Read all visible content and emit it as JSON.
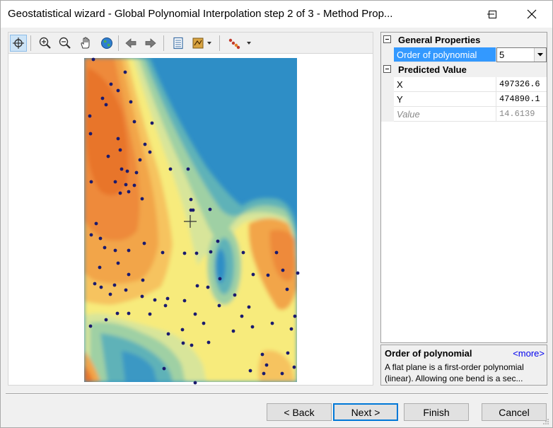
{
  "window": {
    "title": "Geostatistical wizard - Global Polynomial Interpolation step 2 of 3 - Method Prop..."
  },
  "titlebar_icons": [
    "minimize-icon",
    "maximize-icon",
    "close-icon"
  ],
  "toolbar": {
    "icons": [
      "crosshair-icon",
      "zoom-in-icon",
      "zoom-out-icon",
      "pan-hand-icon",
      "full-extent-globe-icon",
      "back-arrow-icon",
      "forward-arrow-icon",
      "table-of-contents-icon",
      "layer-dropdown-icon",
      "symbology-dropdown-icon"
    ]
  },
  "properties": {
    "general_category": "General Properties",
    "order_label": "Order of polynomial",
    "order_value": "5",
    "predicted_category": "Predicted Value",
    "x_label": "X",
    "x_value": "497326.6",
    "y_label": "Y",
    "y_value": "474890.1",
    "value_label": "Value",
    "value_value": "14.6139"
  },
  "help": {
    "title": "Order of polynomial",
    "more": "<more>",
    "description": "A flat plane is a first-order polynomial (linear). Allowing one bend is a sec..."
  },
  "buttons": {
    "back": "< Back",
    "next": "Next >",
    "finish": "Finish",
    "cancel": "Cancel"
  },
  "colors": {
    "accent": "#0078d7",
    "selection": "#3399ff",
    "surface_low": "#2b8cc4",
    "surface_mid": "#f5e36a",
    "surface_high": "#e86a1a",
    "sample_point": "#1a1a6e"
  }
}
